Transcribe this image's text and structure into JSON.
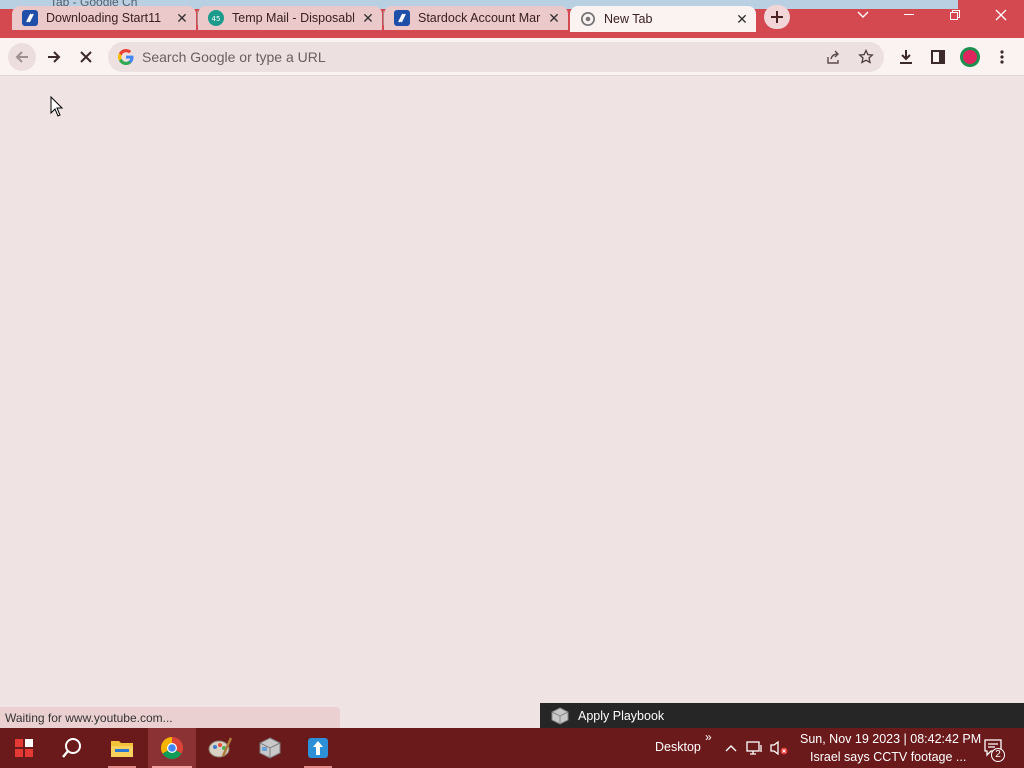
{
  "ghost_window_title": "Tab - Google Ch",
  "tabs": [
    {
      "title": "Downloading Start11",
      "favicon": "stardock-icon",
      "active": false
    },
    {
      "title": "Temp Mail - Disposabl",
      "favicon": "tempmail-icon",
      "active": false
    },
    {
      "title": "Stardock Account Mar",
      "favicon": "stardock-icon",
      "active": false
    },
    {
      "title": "New Tab",
      "favicon": "chrome-icon",
      "active": true
    }
  ],
  "omnibox": {
    "placeholder": "Search Google or type a URL",
    "value": ""
  },
  "status_text": "Waiting for www.youtube.com...",
  "notification": {
    "label": "Apply Playbook"
  },
  "taskbar": {
    "desktop_label": "Desktop",
    "chevron": "»",
    "clock": "Sun, Nov 19 2023 | 08:42:42 PM",
    "news_ticker": "Israel says CCTV footage ...",
    "notification_count": "2"
  },
  "colors": {
    "tabstrip": "#d3494f",
    "toolbar": "#fbf2f2",
    "page_background": "#efe3e3",
    "taskbar": "#6b1a1c",
    "profile_ring": "#1e8f4e",
    "profile_fill": "#e0245e"
  }
}
